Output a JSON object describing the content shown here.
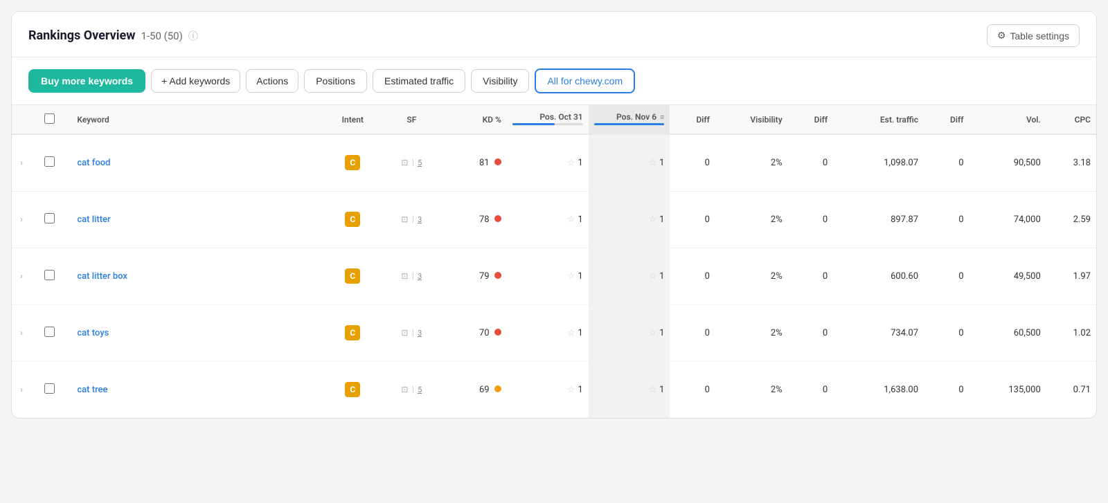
{
  "page": {
    "title": "Rankings Overview",
    "subtitle": "1-50 (50)",
    "info_icon": "ⓘ"
  },
  "toolbar": {
    "table_settings_label": "Table settings",
    "buy_keywords_label": "Buy more keywords",
    "add_keywords_label": "+ Add keywords",
    "actions_label": "Actions",
    "filter_buttons": [
      {
        "id": "positions",
        "label": "Positions",
        "active": false
      },
      {
        "id": "traffic",
        "label": "Estimated traffic",
        "active": false
      },
      {
        "id": "visibility",
        "label": "Visibility",
        "active": false
      },
      {
        "id": "all",
        "label": "All for chewy.com",
        "active": true
      }
    ]
  },
  "table": {
    "columns": [
      {
        "id": "keyword",
        "label": "Keyword",
        "align": "left"
      },
      {
        "id": "intent",
        "label": "Intent",
        "align": "center"
      },
      {
        "id": "sf",
        "label": "SF",
        "align": "center"
      },
      {
        "id": "kd",
        "label": "KD %",
        "align": "right"
      },
      {
        "id": "pos_oct31",
        "label": "Pos. Oct 31",
        "align": "right"
      },
      {
        "id": "pos_nov6",
        "label": "Pos. Nov 6",
        "align": "right",
        "sortable": true,
        "highlight": true
      },
      {
        "id": "diff1",
        "label": "Diff",
        "align": "right"
      },
      {
        "id": "visibility",
        "label": "Visibility",
        "align": "right"
      },
      {
        "id": "diff2",
        "label": "Diff",
        "align": "right"
      },
      {
        "id": "est_traffic",
        "label": "Est. traffic",
        "align": "right"
      },
      {
        "id": "diff3",
        "label": "Diff",
        "align": "right"
      },
      {
        "id": "vol",
        "label": "Vol.",
        "align": "right"
      },
      {
        "id": "cpc",
        "label": "CPC",
        "align": "right"
      }
    ],
    "rows": [
      {
        "keyword": "cat food",
        "intent": "C",
        "sf_num": "5",
        "kd": "81",
        "kd_color": "red",
        "pos_oct31": "1",
        "pos_nov6": "1",
        "diff1": "0",
        "visibility": "2%",
        "diff2": "0",
        "est_traffic": "1,098.07",
        "diff3": "0",
        "vol": "90,500",
        "cpc": "3.18"
      },
      {
        "keyword": "cat litter",
        "intent": "C",
        "sf_num": "3",
        "kd": "78",
        "kd_color": "red",
        "pos_oct31": "1",
        "pos_nov6": "1",
        "diff1": "0",
        "visibility": "2%",
        "diff2": "0",
        "est_traffic": "897.87",
        "diff3": "0",
        "vol": "74,000",
        "cpc": "2.59"
      },
      {
        "keyword": "cat litter box",
        "intent": "C",
        "sf_num": "3",
        "kd": "79",
        "kd_color": "red",
        "pos_oct31": "1",
        "pos_nov6": "1",
        "diff1": "0",
        "visibility": "2%",
        "diff2": "0",
        "est_traffic": "600.60",
        "diff3": "0",
        "vol": "49,500",
        "cpc": "1.97"
      },
      {
        "keyword": "cat toys",
        "intent": "C",
        "sf_num": "3",
        "kd": "70",
        "kd_color": "red",
        "pos_oct31": "1",
        "pos_nov6": "1",
        "diff1": "0",
        "visibility": "2%",
        "diff2": "0",
        "est_traffic": "734.07",
        "diff3": "0",
        "vol": "60,500",
        "cpc": "1.02"
      },
      {
        "keyword": "cat tree",
        "intent": "C",
        "sf_num": "5",
        "kd": "69",
        "kd_color": "orange",
        "pos_oct31": "1",
        "pos_nov6": "1",
        "diff1": "0",
        "visibility": "2%",
        "diff2": "0",
        "est_traffic": "1,638.00",
        "diff3": "0",
        "vol": "135,000",
        "cpc": "0.71"
      }
    ]
  },
  "icons": {
    "gear": "⚙",
    "chevron_right": "›",
    "star": "☆",
    "sort": "≡",
    "camera": "⊡"
  }
}
